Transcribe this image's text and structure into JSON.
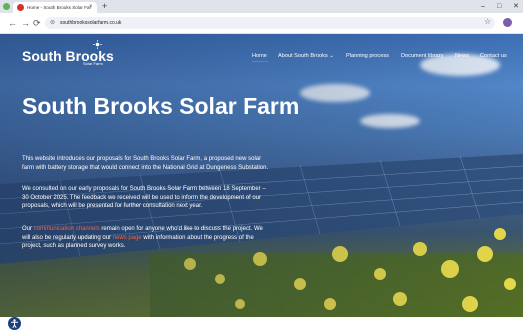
{
  "browser": {
    "tab_title": "Home - South Brooks Solar Far",
    "tab_close": "×",
    "new_tab": "+",
    "url": "southbrookssolarfarm.co.uk",
    "controls": {
      "minimize": "–",
      "maximize": "□",
      "close": "✕"
    }
  },
  "site": {
    "logo": "South Brooks",
    "logo_sub": "Solar Farm",
    "nav": [
      "Home",
      "About South Brooks ⌄",
      "Planning process",
      "Document library",
      "News",
      "Contact us"
    ],
    "title": "South Brooks Solar Farm",
    "para1": "This website introduces our proposals for South Brooks Solar Farm, a proposed new solar farm with battery storage that would connect into the National Grid at Dungeness Substation.",
    "para2": "We consulted on our early proposals for South Brooks Solar Farm between 18 September – 30 October 2025. The feedback we received will be used to inform the development of our proposals, which will be presented for further consultation next year.",
    "para3_pre": "Our ",
    "para3_link1": "communication channels",
    "para3_mid": " remain open for anyone who'd like to discuss the project. We will also be regularly updating our ",
    "para3_link2": "news page",
    "para3_post": " with information about the progress of the project, such as planned survey works."
  },
  "colors": {
    "accent": "#e8674a",
    "accessibility": "#1d3f7a"
  },
  "icons": [
    "back-icon",
    "forward-icon",
    "reload-icon",
    "site-info-icon",
    "star-icon",
    "accessibility-icon"
  ]
}
